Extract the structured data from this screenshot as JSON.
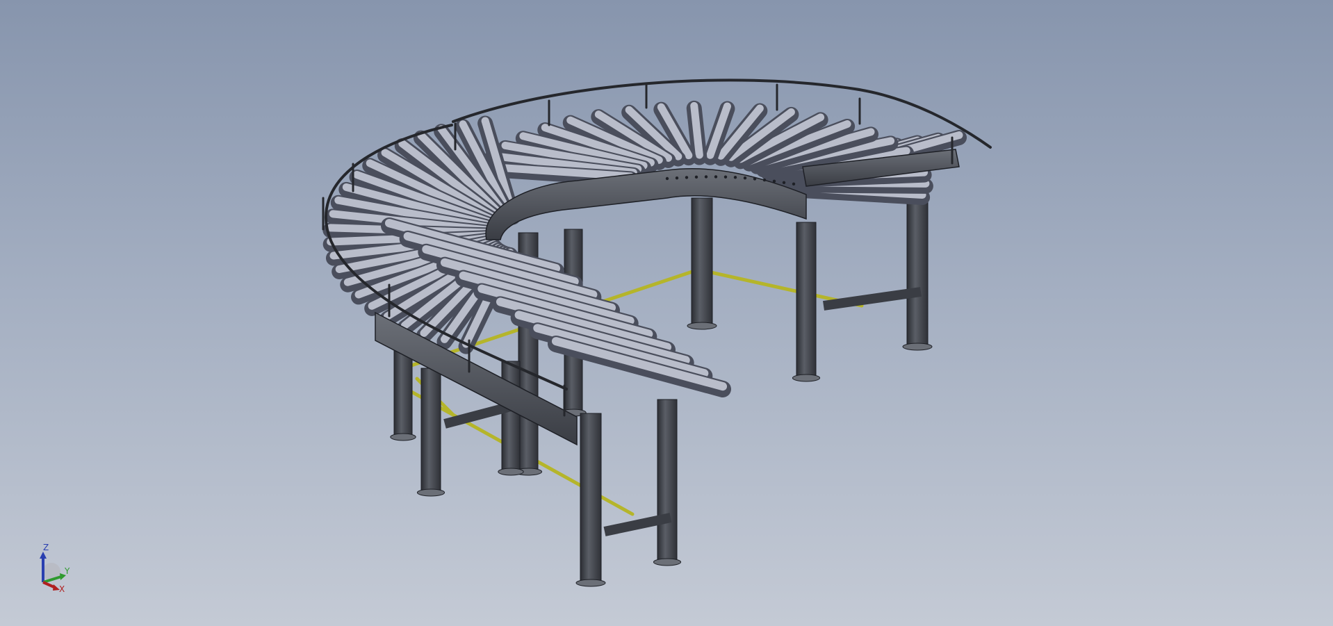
{
  "viewport": {
    "background_top": "#8795ad",
    "background_bottom": "#c4cad5"
  },
  "model": {
    "description_icon": "roller-conveyor-model",
    "colors": {
      "roller_light": "#c5c9d6",
      "roller_dark": "#585c6b",
      "frame": "#3f434c",
      "frame_edge": "#1e2026",
      "leg": "#474b52",
      "leg_dark": "#2b2d33",
      "guard_rail": "#2b2d33",
      "tie_bar": "#b5b52a",
      "tie_bar_dark": "#6c6c14"
    }
  },
  "triad": {
    "z_label": "Z",
    "y_label": "Y",
    "x_label": "X",
    "z_color": "#2a3fb0",
    "y_color": "#2f9a2f",
    "x_color": "#b02020"
  }
}
